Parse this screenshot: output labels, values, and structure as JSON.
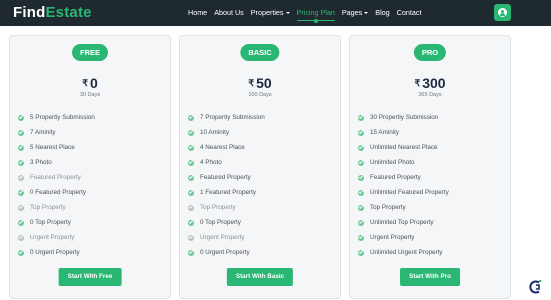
{
  "brand": {
    "part1": "Find",
    "part2": "Estate"
  },
  "nav": {
    "home": "Home",
    "about": "About Us",
    "properties": "Properties",
    "pricing": "Pricing Plan",
    "pages": "Pages",
    "blog": "Blog",
    "contact": "Contact"
  },
  "colors": {
    "accent": "#2ab673",
    "nav_bg": "#1f2a30",
    "card_bg": "#f5f6f8",
    "price_text": "#1b2a3e"
  },
  "icons": {
    "user_button": "user-circle-icon",
    "feature": "check-circle-icon",
    "nav_caret": "chevron-down-icon"
  },
  "plans": [
    {
      "name": "FREE",
      "currency": "₹",
      "price": "0",
      "duration": "30 Days",
      "features": [
        {
          "text": "5 Propertiy Submission",
          "included": true
        },
        {
          "text": "7 Aminity",
          "included": true
        },
        {
          "text": "5 Nearest Place",
          "included": true
        },
        {
          "text": "3 Photo",
          "included": true
        },
        {
          "text": "Featured Property",
          "included": false
        },
        {
          "text": "0 Featured Property",
          "included": true
        },
        {
          "text": "Top Property",
          "included": false
        },
        {
          "text": "0 Top Property",
          "included": true
        },
        {
          "text": "Urgent Property",
          "included": false
        },
        {
          "text": "0 Urgent Property",
          "included": true
        }
      ],
      "cta": "Start With Free"
    },
    {
      "name": "BASIC",
      "currency": "₹",
      "price": "50",
      "duration": "100 Days",
      "features": [
        {
          "text": "7 Propertiy Submission",
          "included": true
        },
        {
          "text": "10 Aminity",
          "included": true
        },
        {
          "text": "4 Nearest Place",
          "included": true
        },
        {
          "text": "4 Photo",
          "included": true
        },
        {
          "text": "Featured Property",
          "included": true
        },
        {
          "text": "1 Featured Property",
          "included": true
        },
        {
          "text": "Top Property",
          "included": false
        },
        {
          "text": "0 Top Property",
          "included": true
        },
        {
          "text": "Urgent Property",
          "included": false
        },
        {
          "text": "0 Urgent Property",
          "included": true
        }
      ],
      "cta": "Start With Basic"
    },
    {
      "name": "PRO",
      "currency": "₹",
      "price": "300",
      "duration": "365 Days",
      "features": [
        {
          "text": "30 Propertiy Submission",
          "included": true
        },
        {
          "text": "15 Aminity",
          "included": true
        },
        {
          "text": "Unlimited Nearest Place",
          "included": true
        },
        {
          "text": "Unlimited Photo",
          "included": true
        },
        {
          "text": "Featured Property",
          "included": true
        },
        {
          "text": "Unlimited Featured Property",
          "included": true
        },
        {
          "text": "Top Property",
          "included": true
        },
        {
          "text": "Unlimited Top Property",
          "included": true
        },
        {
          "text": "Urgent Property",
          "included": true
        },
        {
          "text": "Unlimited Urgent Property",
          "included": true
        }
      ],
      "cta": "Start With Pro"
    }
  ]
}
